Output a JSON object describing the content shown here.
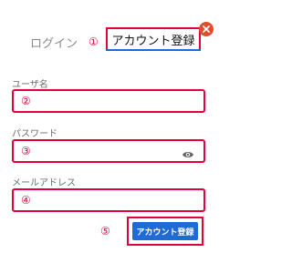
{
  "tabs": {
    "login_label": "ログイン",
    "register_label": "アカウント登録",
    "marker": "①"
  },
  "fields": {
    "username": {
      "label": "ユーザ名",
      "marker": "②",
      "value": ""
    },
    "password": {
      "label": "パスワード",
      "marker": "③",
      "value": "",
      "icon": "eye-icon"
    },
    "email": {
      "label": "メールアドレス",
      "marker": "④",
      "value": ""
    }
  },
  "submit": {
    "label": "アカウント登録",
    "marker": "⑤"
  },
  "close": {
    "icon": "close-icon"
  },
  "colors": {
    "accent": "#1e6bd6",
    "annotation": "#e4003a",
    "close": "#e14c2d"
  }
}
